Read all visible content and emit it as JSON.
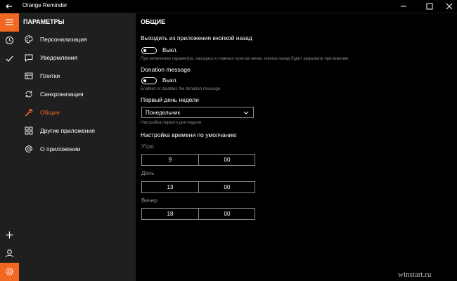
{
  "window": {
    "title": "Orange Reminder"
  },
  "sidebar": {
    "heading": "ПАРАМЕТРЫ",
    "items": [
      {
        "label": "Персонализация",
        "icon": "palette-icon"
      },
      {
        "label": "Уведомления",
        "icon": "message-icon"
      },
      {
        "label": "Плитки",
        "icon": "tiles-icon"
      },
      {
        "label": "Синхронизация",
        "icon": "sync-icon"
      },
      {
        "label": "Общие",
        "icon": "wrench-icon",
        "active": true
      },
      {
        "label": "Другие приложения",
        "icon": "apps-icon"
      },
      {
        "label": "О приложении",
        "icon": "at-icon"
      }
    ]
  },
  "main": {
    "heading": "ОБЩИЕ",
    "back_exit": {
      "label": "Выходить из приложения кнопкой назад",
      "toggle_state": "Выкл.",
      "hint": "При включении параметра, находясь в главных пунктах меню, кнопка назад будет закрывать приложение"
    },
    "donation": {
      "label": "Donation message",
      "toggle_state": "Выкл.",
      "hint": "Enables or disables the donation message"
    },
    "first_day": {
      "label": "Первый день недели",
      "value": "Понедельник",
      "hint": "Настройка первого дня недели"
    },
    "time_defaults": {
      "label": "Настройка времени по умолчанию",
      "morning": {
        "label": "Утро",
        "hour": "9",
        "minute": "00"
      },
      "day": {
        "label": "День",
        "hour": "13",
        "minute": "00"
      },
      "evening": {
        "label": "Вечер",
        "hour": "18",
        "minute": "00"
      }
    }
  },
  "watermark": "winstart.ru",
  "colors": {
    "accent": "#f26722",
    "sidebar_bg": "#1f1f1f",
    "main_bg": "#000000"
  }
}
